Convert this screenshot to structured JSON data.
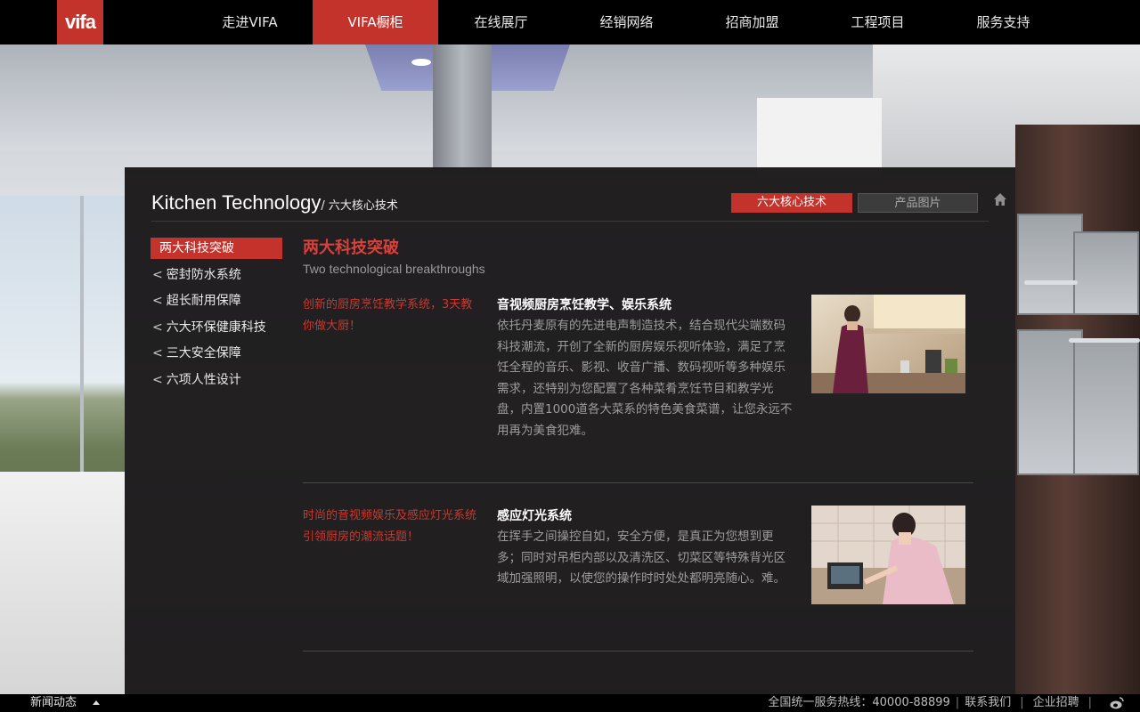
{
  "header": {
    "logo": "vifa",
    "nav": [
      {
        "label": "走进VIFA"
      },
      {
        "label": "VIFA橱柜"
      },
      {
        "label": "在线展厅"
      },
      {
        "label": "经销网络"
      },
      {
        "label": "招商加盟"
      },
      {
        "label": "工程项目"
      },
      {
        "label": "服务支持"
      }
    ],
    "active_index": 1
  },
  "panel": {
    "title_en": "Kitchen Technology",
    "title_cn": "/ 六大核心技术",
    "tabs": [
      {
        "label": "六大核心技术",
        "active": true
      },
      {
        "label": "产品图片",
        "active": false
      }
    ],
    "home_icon": "home-icon"
  },
  "sidebar": {
    "items": [
      {
        "label": "两大科技突破",
        "active": true
      },
      {
        "label": "密封防水系统",
        "active": false
      },
      {
        "label": "超长耐用保障",
        "active": false
      },
      {
        "label": "六大环保健康科技",
        "active": false
      },
      {
        "label": "三大安全保障",
        "active": false
      },
      {
        "label": "六项人性设计",
        "active": false
      }
    ],
    "chevron": "<"
  },
  "content": {
    "title": "两大科技突破",
    "subtitle": "Two technological breakthroughs",
    "features": [
      {
        "lead": "创新的厨房烹饪教学系统，3天教你做大厨！",
        "heading": "音视频厨房烹饪教学、娱乐系统",
        "text": "依托丹麦原有的先进电声制造技术，结合现代尖端数码科技潮流，开创了全新的厨房娱乐视听体验，满足了烹饪全程的音乐、影视、收音广播、数码视听等多种娱乐需求，还特别为您配置了各种菜肴烹饪节目和教学光盘，内置1000道各大菜系的特色美食菜谱，让您永远不用再为美食犯难。"
      },
      {
        "lead": "时尚的音视频娱乐及感应灯光系统引领厨房的潮流话题！",
        "heading": "感应灯光系统",
        "text": "在挥手之间操控自如，安全方便，是真正为您想到更多；同时对吊柜内部以及清洗区、切菜区等特殊背光区域加强照明，以使您的操作时时处处都明亮随心。难。"
      }
    ]
  },
  "footer": {
    "news": "新闻动态",
    "hotline": "全国统一服务热线：40000-88899",
    "contact": "联系我们",
    "jobs": "企业招聘",
    "separator": "|",
    "social_icon": "weibo-icon"
  },
  "colors": {
    "accent": "#c3332c",
    "panel_bg": "#121011",
    "lead_text": "#c9392f"
  }
}
